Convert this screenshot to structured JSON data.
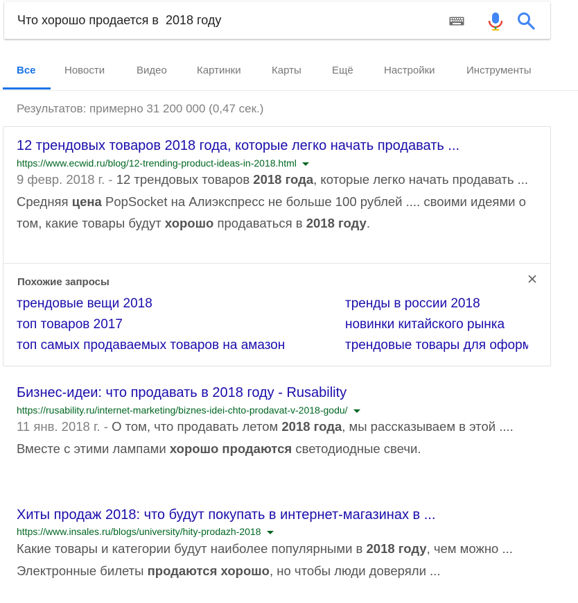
{
  "search": {
    "query": "Что хорошо продается в  2018 году",
    "keyboard_icon": "keyboard-icon",
    "mic_icon": "microphone-icon",
    "search_icon": "search-icon"
  },
  "tabs": [
    {
      "label": "Все",
      "active": true
    },
    {
      "label": "Новости"
    },
    {
      "label": "Видео"
    },
    {
      "label": "Картинки"
    },
    {
      "label": "Карты"
    },
    {
      "label": "Ещё"
    },
    {
      "label": "Настройки"
    },
    {
      "label": "Инструменты"
    }
  ],
  "stats": "Результатов: примерно 31 200 000 (0,47 сек.)",
  "results": [
    {
      "title": "12 трендовых товаров 2018 года, которые легко начать продавать ...",
      "url": "https://www.ecwid.ru/blog/12-trending-product-ideas-in-2018.html",
      "date": "9 февр. 2018 г. - ",
      "snippet": [
        {
          "t": "12 трендовых товаров "
        },
        {
          "t": "2018 года",
          "b": true
        },
        {
          "t": ", которые легко начать продавать ... Средняя "
        },
        {
          "t": "цена",
          "b": true
        },
        {
          "t": " PopSocket на Алиэкспресс не больше 100 рублей .... своими идеями о том, какие товары будут "
        },
        {
          "t": "хорошо",
          "b": true
        },
        {
          "t": " продаваться в "
        },
        {
          "t": "2018 году",
          "b": true
        },
        {
          "t": "."
        }
      ]
    },
    {
      "title": "Бизнес-идеи: что продавать в 2018 году - Rusability",
      "url": "https://rusability.ru/internet-marketing/biznes-idei-chto-prodavat-v-2018-godu/",
      "date": "11 янв. 2018 г. - ",
      "snippet": [
        {
          "t": "О том, что продавать летом "
        },
        {
          "t": "2018 года",
          "b": true
        },
        {
          "t": ", мы рассказываем в этой .... Вместе с этими лампами "
        },
        {
          "t": "хорошо продаются",
          "b": true
        },
        {
          "t": " светодиодные свечи."
        }
      ]
    },
    {
      "title": "Хиты продаж 2018: что будут покупать в интернет-магазинах в ...",
      "url": "https://www.insales.ru/blogs/university/hity-prodazh-2018",
      "date": "",
      "snippet": [
        {
          "t": "Какие товары и категории будут наиболее популярными в "
        },
        {
          "t": "2018 году",
          "b": true
        },
        {
          "t": ", чем можно ... Электронные билеты "
        },
        {
          "t": "продаются хорошо",
          "b": true
        },
        {
          "t": ", но чтобы люди доверяли ..."
        }
      ]
    }
  ],
  "related": {
    "heading": "Похожие запросы",
    "left": [
      "трендовые вещи 2018",
      "топ товаров 2017",
      "топ самых продаваемых товаров на амазон"
    ],
    "right": [
      "тренды в россии 2018",
      "новинки китайского рынка",
      "трендовые товары для оформления"
    ]
  }
}
